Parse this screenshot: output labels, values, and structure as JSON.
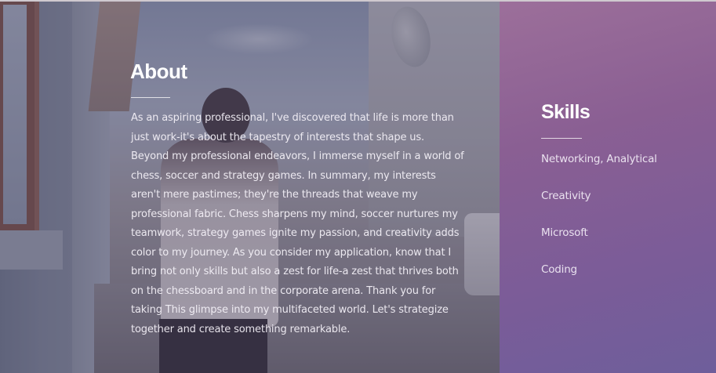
{
  "about": {
    "title": "About",
    "body": "As an aspiring professional, I've discovered that life is more than just work-it's about the tapestry of interests that shape us. Beyond my professional endeavors, I immerse myself in a world of chess, soccer and strategy games. In summary, my interests aren't mere pastimes; they're the threads that weave my professional fabric. Chess sharpens my mind, soccer nurtures my teamwork, strategy games ignite my passion, and creativity adds color to my journey. As you consider my application, know that I bring not only skills but also a zest for life-a zest that thrives both on the chessboard and in the corporate arena. Thank you for taking This glimpse into my multifaceted world. Let's strategize together and create something remarkable."
  },
  "skills": {
    "title": "Skills",
    "items": [
      "Networking, Analytical",
      "Creativity",
      "Microsoft",
      "Coding"
    ]
  },
  "colors": {
    "panel_gradient_start": "#9c6f9a",
    "panel_gradient_end": "#6e5e9b",
    "heading_text": "#ffffff"
  }
}
